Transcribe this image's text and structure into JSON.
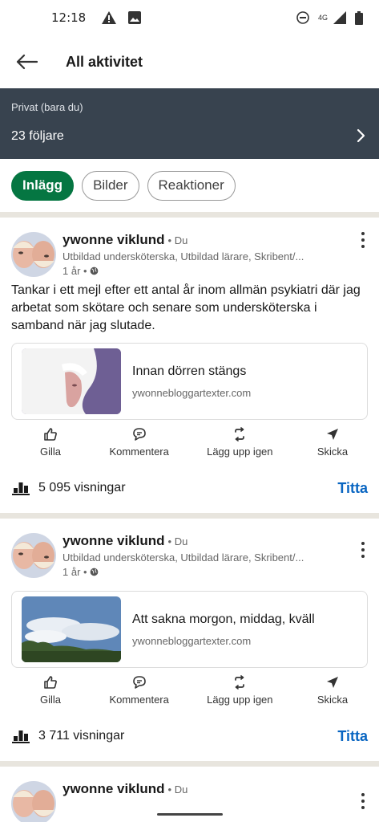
{
  "status_bar": {
    "time": "12:18",
    "network": "4G",
    "icons": [
      "warning-icon",
      "image-icon",
      "dnd-icon",
      "signal-icon",
      "battery-icon"
    ]
  },
  "header": {
    "title": "All aktivitet",
    "back_icon": "arrow-left-icon"
  },
  "privacy_banner": {
    "visibility": "Privat (bara du)",
    "followers": "23 följare"
  },
  "filters": [
    {
      "label": "Inlägg",
      "active": true
    },
    {
      "label": "Bilder",
      "active": false
    },
    {
      "label": "Reaktioner",
      "active": false
    }
  ],
  "actions": {
    "like": "Gilla",
    "comment": "Kommentera",
    "repost": "Lägg upp igen",
    "send": "Skicka"
  },
  "posts": [
    {
      "author": "ywonne viklund",
      "du": "• Du",
      "headline": "Utbildad undersköterska, Utbildad lärare, Skribent/...",
      "age": "1 år •",
      "text": "Tankar i ett mejl efter ett antal år inom allmän psykiatri där jag arbetat som skötare och senare som undersköterska i samband när jag slutade.",
      "link": {
        "title": "Innan dörren stängs",
        "domain": "ywonnebloggartexter.com"
      },
      "views": "5 095 visningar",
      "view_link": "Titta"
    },
    {
      "author": "ywonne viklund",
      "du": "• Du",
      "headline": "Utbildad undersköterska, Utbildad lärare, Skribent/...",
      "age": "1 år •",
      "text": "",
      "link": {
        "title": "Att sakna morgon, middag, kväll",
        "domain": "ywonnebloggartexter.com"
      },
      "views": "3 711 visningar",
      "view_link": "Titta"
    },
    {
      "author": "ywonne viklund",
      "du": "• Du"
    }
  ],
  "colors": {
    "banner_bg": "#38434f",
    "chip_active": "#057642",
    "link_blue": "#0a66c2",
    "divider": "#e8e5de"
  }
}
